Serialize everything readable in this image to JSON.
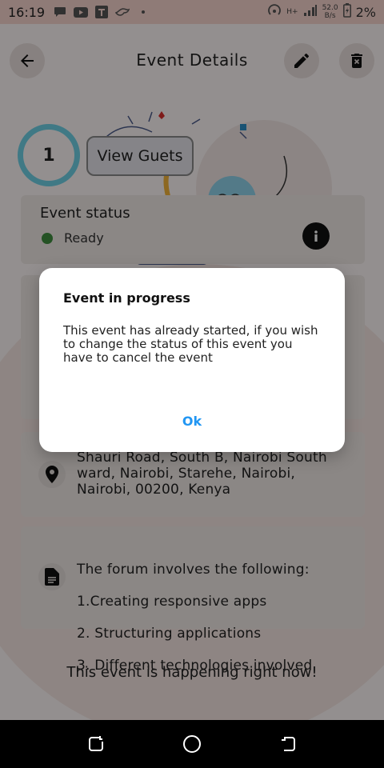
{
  "status_bar": {
    "time": "16:19",
    "net_speed_value": "52.0",
    "net_speed_unit": "B/s",
    "network_label": "H+",
    "battery": "2%"
  },
  "app_bar": {
    "title": "Event Details",
    "icons": [
      "arrow-back-icon",
      "edit-icon",
      "delete-icon"
    ]
  },
  "guests": {
    "count": "1",
    "button_label": "View Guets"
  },
  "event_status": {
    "title": "Event status",
    "value": "Ready",
    "dot_color": "#3e8e3e"
  },
  "address": {
    "text": "Shauri Road, South B, Nairobi South ward, Nairobi, Starehe, Nairobi, Nairobi, 00200, Kenya"
  },
  "description": {
    "lines": [
      "The forum involves the following:",
      "1.Creating responsive apps",
      "2. Structuring applications",
      "3. Different technologies involved"
    ]
  },
  "footer_message": "This event is happening right now!",
  "dialog": {
    "title": "Event in progress",
    "body": "This event has already started, if you wish to change the status of this event you have to cancel the event",
    "ok_label": "Ok",
    "ok_color": "#2196f3"
  },
  "colors": {
    "status_bar_bg": "#f7d4cd",
    "ring": "#6fd0e6",
    "scrim": "rgba(0,0,0,0.42)"
  }
}
